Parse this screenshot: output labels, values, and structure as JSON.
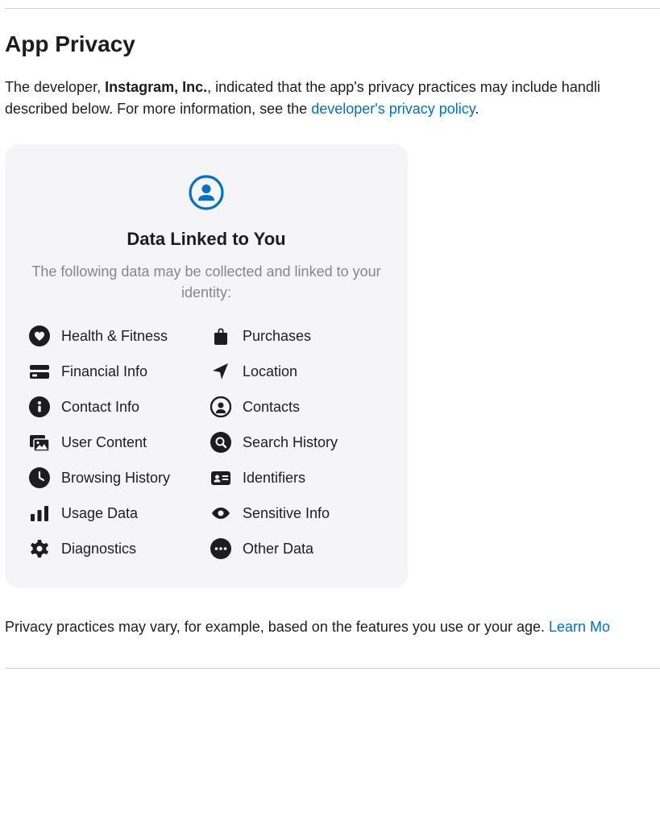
{
  "section_title": "App Privacy",
  "intro": {
    "prefix": "The developer, ",
    "developer": "Instagram, Inc.",
    "mid": ", indicated that the app's privacy practices may include handli",
    "line2_prefix": "described below. For more information, see the ",
    "link_text": "developer's privacy policy",
    "suffix": "."
  },
  "card": {
    "title": "Data Linked to You",
    "subtitle": "The following data may be collected and linked to your identity:",
    "items": [
      {
        "icon": "heart-circle-icon",
        "label": "Health & Fitness"
      },
      {
        "icon": "bag-icon",
        "label": "Purchases"
      },
      {
        "icon": "credit-card-icon",
        "label": "Financial Info"
      },
      {
        "icon": "location-arrow-icon",
        "label": "Location"
      },
      {
        "icon": "info-circle-icon",
        "label": "Contact Info"
      },
      {
        "icon": "person-circle-icon",
        "label": "Contacts"
      },
      {
        "icon": "photo-icon",
        "label": "User Content"
      },
      {
        "icon": "search-circle-icon",
        "label": "Search History"
      },
      {
        "icon": "clock-icon",
        "label": "Browsing History"
      },
      {
        "icon": "id-card-icon",
        "label": "Identifiers"
      },
      {
        "icon": "bars-icon",
        "label": "Usage Data"
      },
      {
        "icon": "eye-icon",
        "label": "Sensitive Info"
      },
      {
        "icon": "gear-icon",
        "label": "Diagnostics"
      },
      {
        "icon": "dots-circle-icon",
        "label": "Other Data"
      }
    ]
  },
  "footer": {
    "text": "Privacy practices may vary, for example, based on the features you use or your age. ",
    "link_text": "Learn Mo"
  }
}
